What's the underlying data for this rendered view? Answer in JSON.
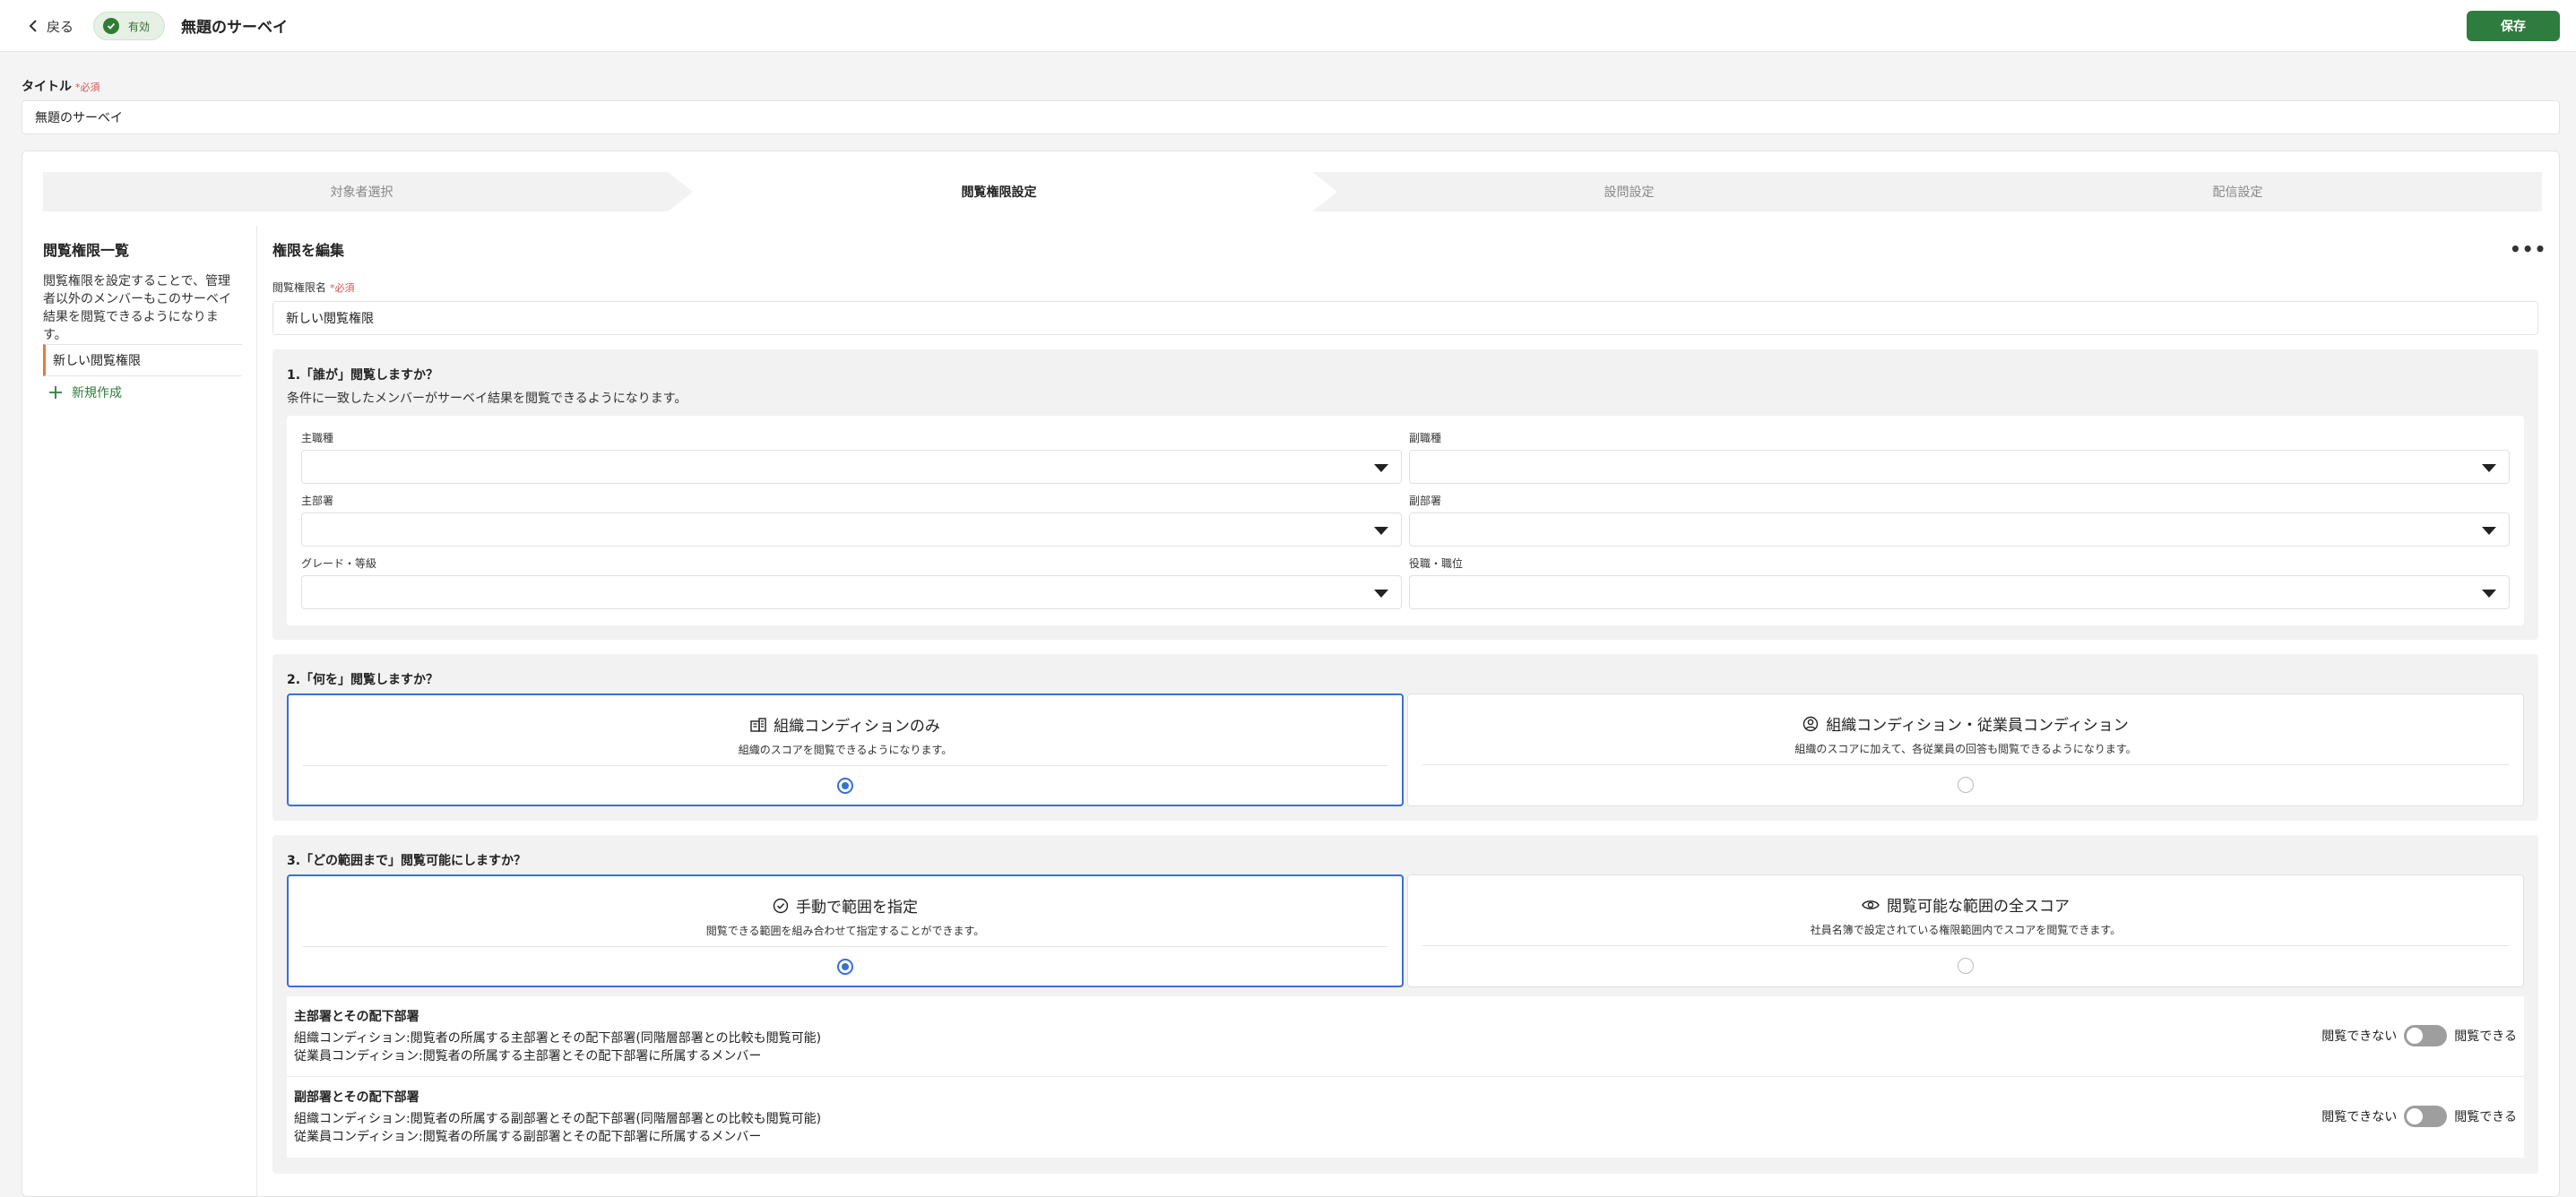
{
  "header": {
    "back_label": "戻る",
    "status_badge": "有効",
    "survey_title": "無題のサーベイ",
    "save_label": "保存"
  },
  "title_field": {
    "label": "タイトル",
    "required": "*必須",
    "value": "無題のサーベイ"
  },
  "steps": [
    {
      "label": "対象者選択",
      "active": false
    },
    {
      "label": "閲覧権限設定",
      "active": true
    },
    {
      "label": "設問設定",
      "active": false
    },
    {
      "label": "配信設定",
      "active": false
    }
  ],
  "sidebar": {
    "title": "閲覧権限一覧",
    "description": "閲覧権限を設定することで、管理者以外のメンバーもこのサーベイ結果を閲覧できるようになります。",
    "items": [
      {
        "label": "新しい閲覧権限",
        "selected": true
      }
    ],
    "add_label": "新規作成"
  },
  "editor": {
    "title": "権限を編集",
    "more_label": "•••",
    "name_label": "閲覧権限名",
    "name_required": "*必須",
    "name_value": "新しい閲覧権限"
  },
  "section1": {
    "title": "1.「誰が」閲覧しますか？",
    "description": "条件に一致したメンバーがサーベイ結果を閲覧できるようになります。",
    "filters": [
      {
        "label": "主職種",
        "value": ""
      },
      {
        "label": "副職種",
        "value": ""
      },
      {
        "label": "主部署",
        "value": ""
      },
      {
        "label": "副部署",
        "value": ""
      },
      {
        "label": "グレード・等級",
        "value": ""
      },
      {
        "label": "役職・職位",
        "value": ""
      }
    ]
  },
  "section2": {
    "title": "2.「何を」閲覧しますか？",
    "options": [
      {
        "icon": "building-icon",
        "title": "組織コンディションのみ",
        "description": "組織のスコアを閲覧できるようになります。",
        "selected": true
      },
      {
        "icon": "user-circle-icon",
        "title": "組織コンディション・従業員コンディション",
        "description": "組織のスコアに加えて、各従業員の回答も閲覧できるようになります。",
        "selected": false
      }
    ]
  },
  "section3": {
    "title": "3.「どの範囲まで」閲覧可能にしますか？",
    "options": [
      {
        "icon": "check-circle-icon",
        "title": "手動で範囲を指定",
        "description": "閲覧できる範囲を組み合わせて指定することができます。",
        "selected": true
      },
      {
        "icon": "eye-icon",
        "title": "閲覧可能な範囲の全スコア",
        "description": "社員名簿で設定されている権限範囲内でスコアを閲覧できます。",
        "selected": false
      }
    ],
    "scopes": [
      {
        "title": "主部署とその配下部署",
        "org_line": "組織コンディション:閲覧者の所属する主部署とその配下部署(同階層部署との比較も閲覧可能)",
        "emp_line": "従業員コンディション:閲覧者の所属する主部署とその配下部署に所属するメンバー",
        "off_label": "閲覧できない",
        "on_label": "閲覧できる",
        "enabled": false
      },
      {
        "title": "副部署とその配下部署",
        "org_line": "組織コンディション:閲覧者の所属する副部署とその配下部署(同階層部署との比較も閲覧可能)",
        "emp_line": "従業員コンディション:閲覧者の所属する副部署とその配下部署に所属するメンバー",
        "off_label": "閲覧できない",
        "on_label": "閲覧できる",
        "enabled": false
      }
    ]
  },
  "colors": {
    "primary_green": "#2e7d3e",
    "selected_blue": "#3a6fd8",
    "active_tab_accent": "#e57a3b"
  }
}
